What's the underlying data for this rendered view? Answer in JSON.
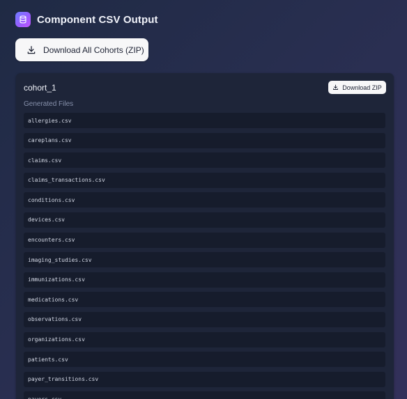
{
  "header": {
    "title": "Component CSV Output",
    "icon": "database-icon"
  },
  "actions": {
    "download_all_label": "Download All Cohorts (ZIP)"
  },
  "cohort": {
    "name": "cohort_1",
    "download_zip_label": "Download ZIP",
    "section_label": "Generated Files",
    "files": [
      "allergies.csv",
      "careplans.csv",
      "claims.csv",
      "claims_transactions.csv",
      "conditions.csv",
      "devices.csv",
      "encounters.csv",
      "imaging_studies.csv",
      "immunizations.csv",
      "medications.csv",
      "observations.csv",
      "organizations.csv",
      "patients.csv",
      "payer_transitions.csv",
      "payers.csv"
    ]
  },
  "colors": {
    "accent_gradient_start": "#6f7cff",
    "accent_gradient_end": "#c455ff",
    "card_background": "#1e2539",
    "file_row_background": "#161c2c"
  }
}
